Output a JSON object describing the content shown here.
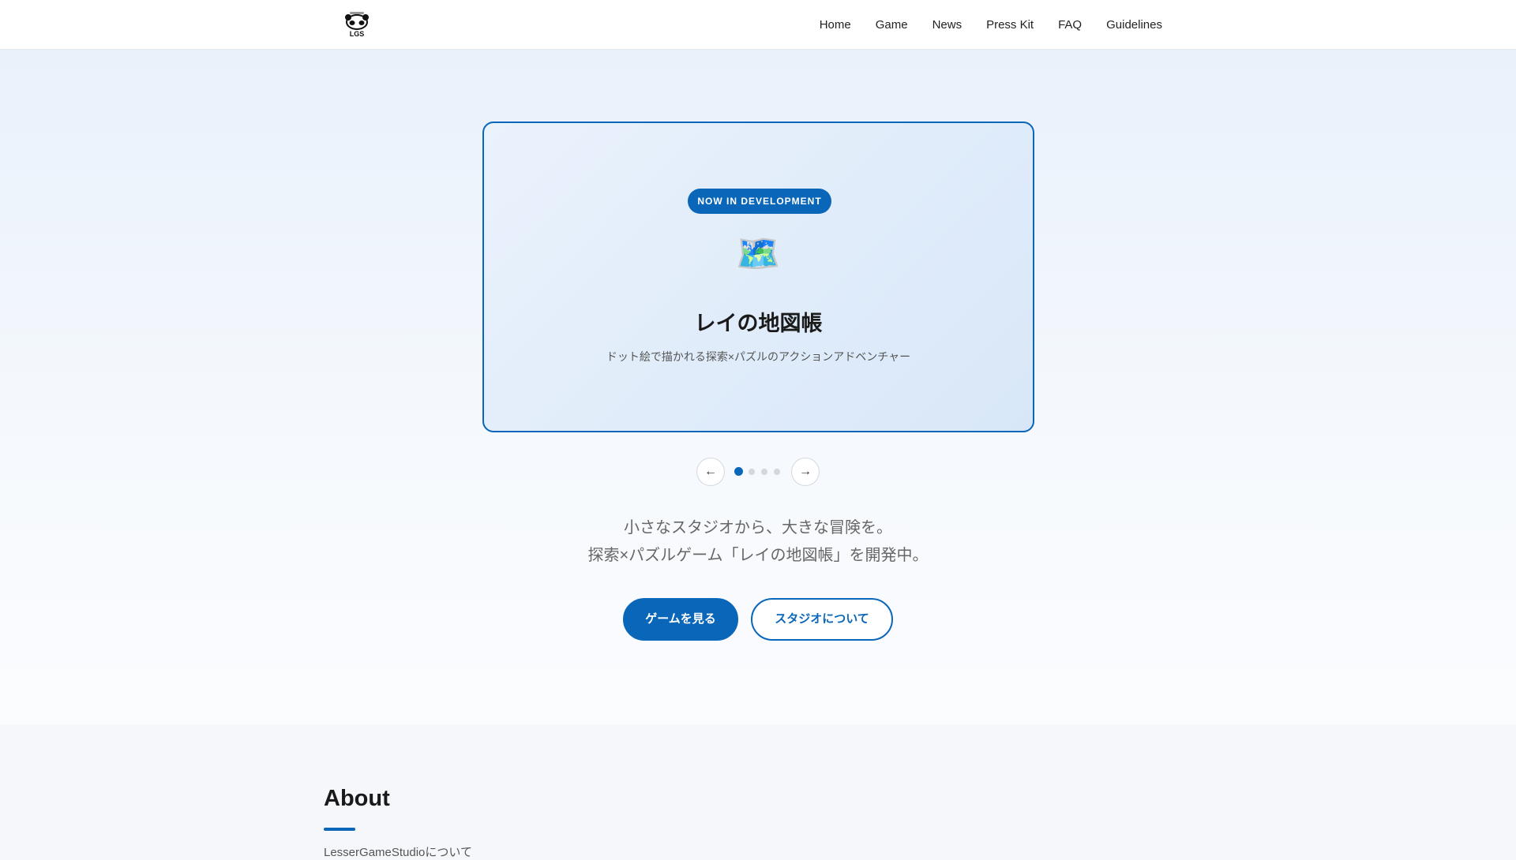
{
  "nav": {
    "logo_text": "LGS",
    "items": [
      "Home",
      "Game",
      "News",
      "Press Kit",
      "FAQ",
      "Guidelines"
    ]
  },
  "hero": {
    "card": {
      "badge": "NOW IN DEVELOPMENT",
      "emoji": "🗺️",
      "title": "レイの地図帳",
      "subtitle": "ドット絵で描かれる探索×パズルのアクションアドベンチャー"
    },
    "carousel": {
      "prev": "←",
      "next": "→",
      "slides": 4,
      "active": 1
    },
    "tagline": [
      "小さなスタジオから、大きな冒険を。",
      "探索×パズルゲーム「レイの地図帳」を開発中。"
    ],
    "buttons": {
      "primary": "ゲームを見る",
      "secondary": "スタジオについて"
    }
  },
  "about": {
    "heading": "About",
    "text": "LesserGameStudioについて"
  },
  "colors": {
    "accent": "#0a66b8"
  }
}
